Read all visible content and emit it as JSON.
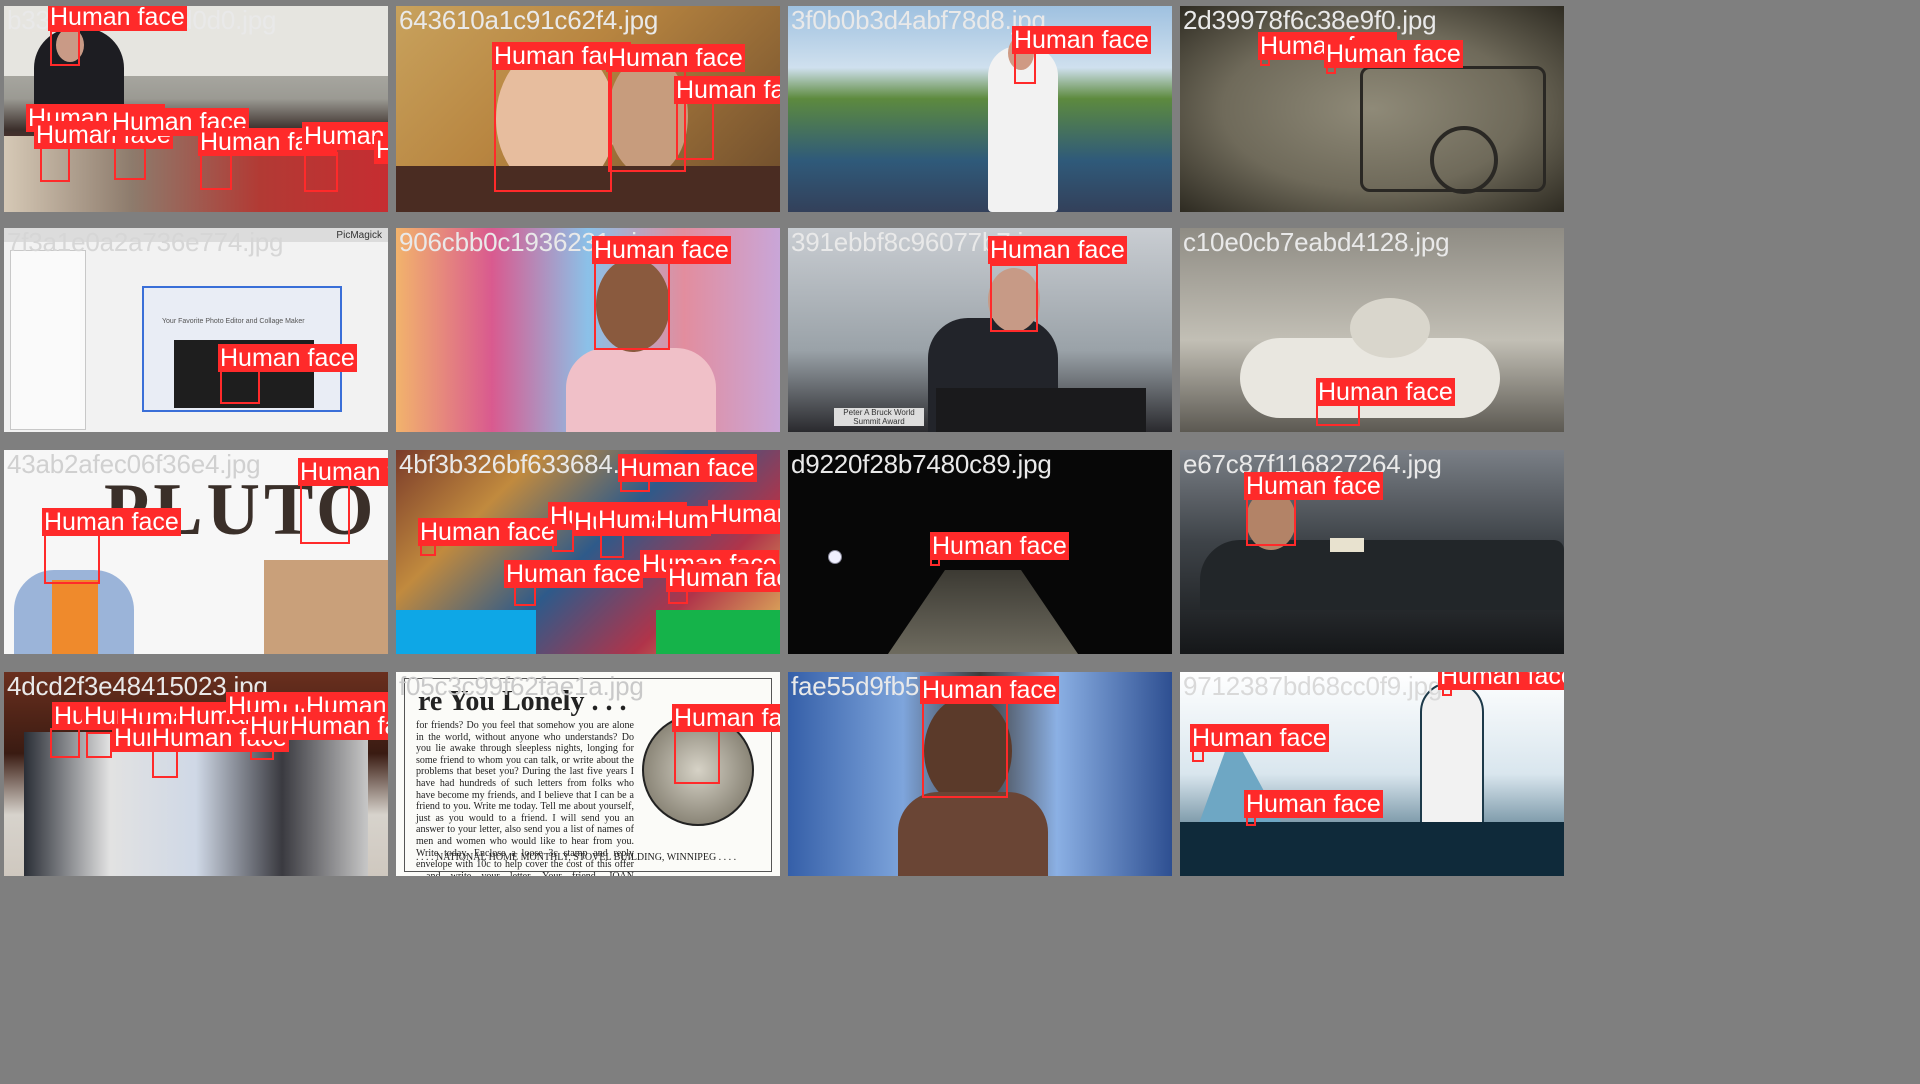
{
  "grid_title": "",
  "box_color": "#ff2a2a",
  "tiles": [
    {
      "filename": "b33a10a0a2a6d0d0.jpg",
      "labels": [
        "Human face",
        "Human face",
        "Human face",
        "Human face",
        "Human face",
        "Human face",
        "Human face"
      ]
    },
    {
      "filename": "643610a1c91c62f4.jpg",
      "labels": [
        "Human face",
        "Human face",
        "Human face"
      ]
    },
    {
      "filename": "3f0b0b3d4abf78d8.jpg",
      "labels": [
        "Human face"
      ]
    },
    {
      "filename": "2d39978f6c38e9f0.jpg",
      "labels": [
        "Human face",
        "Human face"
      ]
    },
    {
      "filename": "7f3a1e0a2a736e774.jpg",
      "labels": [
        "Human face"
      ],
      "app_brand": "PicMagick",
      "inner_tagline": "Your Favorite Photo Editor and Collage Maker"
    },
    {
      "filename": "906cbb0c1936231a.jpg",
      "labels": [
        "Human face"
      ]
    },
    {
      "filename": "391ebbf8c96077b7.jpg",
      "labels": [
        "Human face"
      ],
      "placard": "Peter A Bruck World Summit Award"
    },
    {
      "filename": "c10e0cb7eabd4128.jpg",
      "labels": [
        "Human face"
      ]
    },
    {
      "filename": "43ab2afec06f36e4.jpg",
      "labels": [
        "Human face",
        "Human face"
      ],
      "title_art": "PLUTO"
    },
    {
      "filename": "4bf3b326bf633684.jpg",
      "labels": [
        "Human face",
        "Human face",
        "Human face",
        "Human face",
        "Human face",
        "Human face",
        "Human face",
        "Human face",
        "Human face",
        "Human face",
        "Human face"
      ]
    },
    {
      "filename": "d9220f28b7480c89.jpg",
      "labels": [
        "Human face"
      ]
    },
    {
      "filename": "e67c87f116827264.jpg",
      "labels": [
        "Human face"
      ]
    },
    {
      "filename": "4dcd2f3e48415023.jpg",
      "labels": [
        "Human face",
        "Human face",
        "Human face",
        "Human face",
        "Human face",
        "Human face",
        "Human face",
        "Human face",
        "Human face",
        "Human face",
        "Human face"
      ]
    },
    {
      "filename": "f05c3c99f62fae1a.jpg",
      "labels": [
        "Human face"
      ],
      "ad_heading": "re You Lonely . . .",
      "ad_body": "for friends? Do you feel that somehow you are alone in the world, without anyone who understands? Do you lie awake through sleepless nights, longing for some friend to whom you can talk, or write about the problems that beset you? During the last five years I have had hundreds of such letters from folks who have become my friends, and I believe that I can be a friend to you. Write me today. Tell me about yourself, just as you would to a friend. I will send you an answer to your letter, also send you a list of names of men and women who would like to hear from you. Write today. Enclose a loose 3c stamp and reply envelope with 10c to help cover the cost of this offer—and write your letter. Your friend. JOAN REMINGTON, care of:",
      "ad_footer": ". . . . NATIONAL HOME MONTHLY, STOVEL BUILDING, WINNIPEG . . . ."
    },
    {
      "filename": "fae55d9fb5b0c6a2.jpg",
      "labels": [
        "Human face"
      ]
    },
    {
      "filename": "9712387bd68cc0f9.jpg",
      "labels": [
        "Human face",
        "Human face",
        "Human face"
      ]
    }
  ]
}
